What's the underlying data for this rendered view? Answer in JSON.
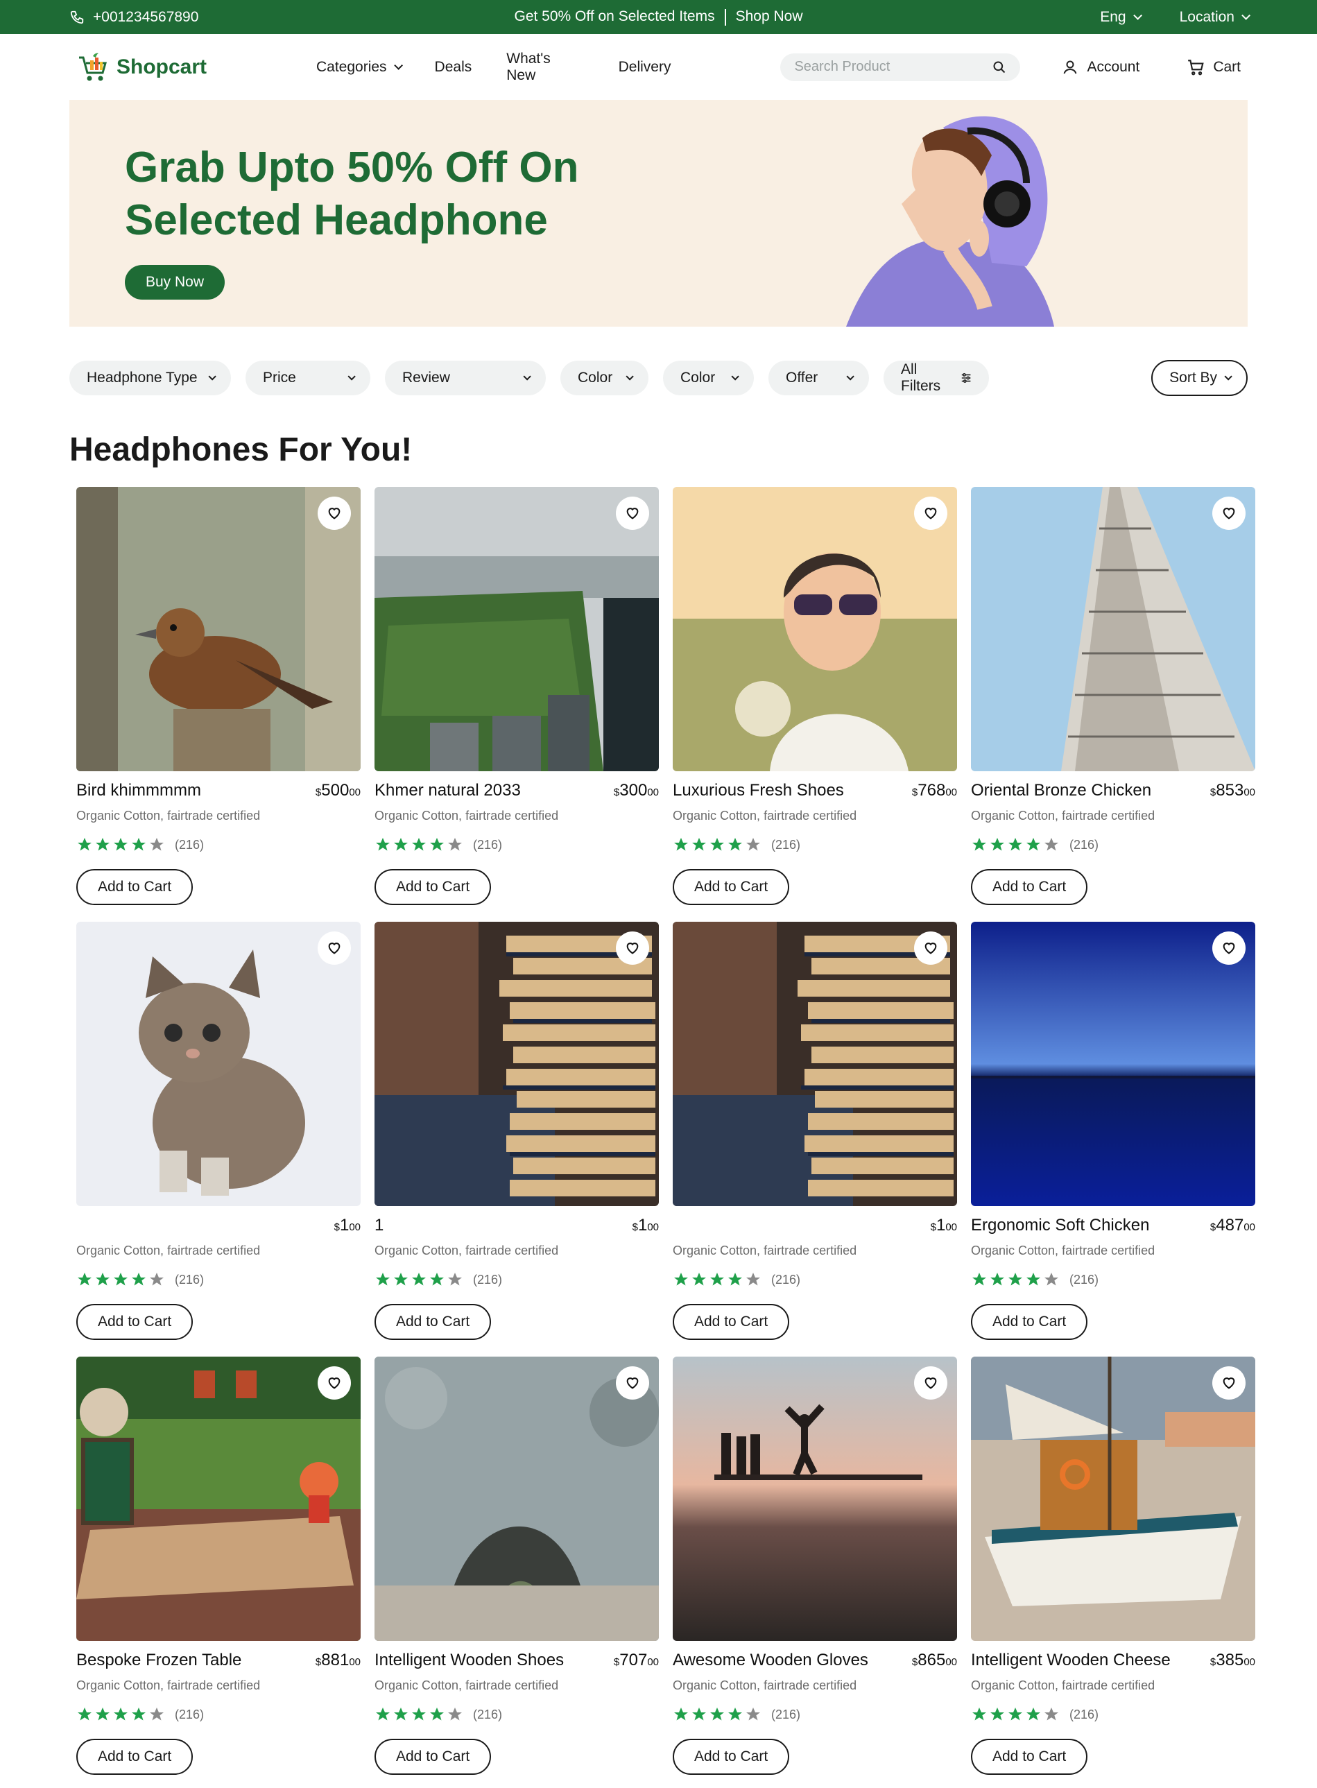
{
  "topbar": {
    "phone": "+001234567890",
    "promo_text": "Get 50% Off on Selected Items",
    "promo_link": "Shop Now",
    "language": "Eng",
    "location": "Location"
  },
  "header": {
    "logo_text": "Shopcart",
    "nav": [
      "Categories",
      "Deals",
      "What's New",
      "Delivery"
    ],
    "search_placeholder": "Search Product",
    "account_label": "Account",
    "cart_label": "Cart"
  },
  "hero": {
    "headline_line1": "Grab Upto 50% Off On",
    "headline_line2": "Selected Headphone",
    "cta": "Buy Now"
  },
  "filters": {
    "items": [
      "Headphone Type",
      "Price",
      "Review",
      "Color",
      "Color",
      "Offer",
      "All Filters"
    ],
    "sort_label": "Sort By"
  },
  "section_title": "Headphones For You!",
  "colors": {
    "brand_green": "#1e6b35",
    "star_green": "#1fa04a",
    "star_gray": "#8a8a8a",
    "hero_bg": "#f9efe3"
  },
  "products": [
    {
      "title": "Bird khimmmmm",
      "currency": "$",
      "price": "500",
      "cents": "00",
      "subtitle": "Organic Cotton, fairtrade certified",
      "rating": 4,
      "reviews": "(216)",
      "button": "Add to Cart",
      "image": "bird"
    },
    {
      "title": "Khmer natural 2033",
      "currency": "$",
      "price": "300",
      "cents": "00",
      "subtitle": "Organic Cotton, fairtrade certified",
      "rating": 4,
      "reviews": "(216)",
      "button": "Add to Cart",
      "image": "city-park"
    },
    {
      "title": "Luxurious Fresh Shoes",
      "currency": "$",
      "price": "768",
      "cents": "00",
      "subtitle": "Organic Cotton, fairtrade certified",
      "rating": 4,
      "reviews": "(216)",
      "button": "Add to Cart",
      "image": "woman-sunglasses"
    },
    {
      "title": "Oriental Bronze Chicken",
      "currency": "$",
      "price": "853",
      "cents": "00",
      "subtitle": "Organic Cotton, fairtrade certified",
      "rating": 4,
      "reviews": "(216)",
      "button": "Add to Cart",
      "image": "skyscraper"
    },
    {
      "title": "",
      "currency": "$",
      "price": "1",
      "cents": "00",
      "subtitle": "Organic Cotton, fairtrade certified",
      "rating": 4,
      "reviews": "(216)",
      "button": "Add to Cart",
      "image": "kitten"
    },
    {
      "title": "1",
      "currency": "$",
      "price": "1",
      "cents": "00",
      "subtitle": "Organic Cotton, fairtrade certified",
      "rating": 4,
      "reviews": "(216)",
      "button": "Add to Cart",
      "image": "books"
    },
    {
      "title": "",
      "currency": "$",
      "price": "1",
      "cents": "00",
      "subtitle": "Organic Cotton, fairtrade certified",
      "rating": 4,
      "reviews": "(216)",
      "button": "Add to Cart",
      "image": "books"
    },
    {
      "title": "Ergonomic Soft Chicken",
      "currency": "$",
      "price": "487",
      "cents": "00",
      "subtitle": "Organic Cotton, fairtrade certified",
      "rating": 4,
      "reviews": "(216)",
      "button": "Add to Cart",
      "image": "blue-sea"
    },
    {
      "title": "Bespoke Frozen Table",
      "currency": "$",
      "price": "881",
      "cents": "00",
      "subtitle": "Organic Cotton, fairtrade certified",
      "rating": 4,
      "reviews": "(216)",
      "button": "Add to Cart",
      "image": "cafe"
    },
    {
      "title": "Intelligent Wooden Shoes",
      "currency": "$",
      "price": "707",
      "cents": "00",
      "subtitle": "Organic Cotton, fairtrade certified",
      "rating": 4,
      "reviews": "(216)",
      "button": "Add to Cart",
      "image": "rock-arch"
    },
    {
      "title": "Awesome Wooden Gloves",
      "currency": "$",
      "price": "865",
      "cents": "00",
      "subtitle": "Organic Cotton, fairtrade certified",
      "rating": 4,
      "reviews": "(216)",
      "button": "Add to Cart",
      "image": "sunset-jump"
    },
    {
      "title": "Intelligent Wooden Cheese",
      "currency": "$",
      "price": "385",
      "cents": "00",
      "subtitle": "Organic Cotton, fairtrade certified",
      "rating": 4,
      "reviews": "(216)",
      "button": "Add to Cart",
      "image": "boat"
    }
  ]
}
